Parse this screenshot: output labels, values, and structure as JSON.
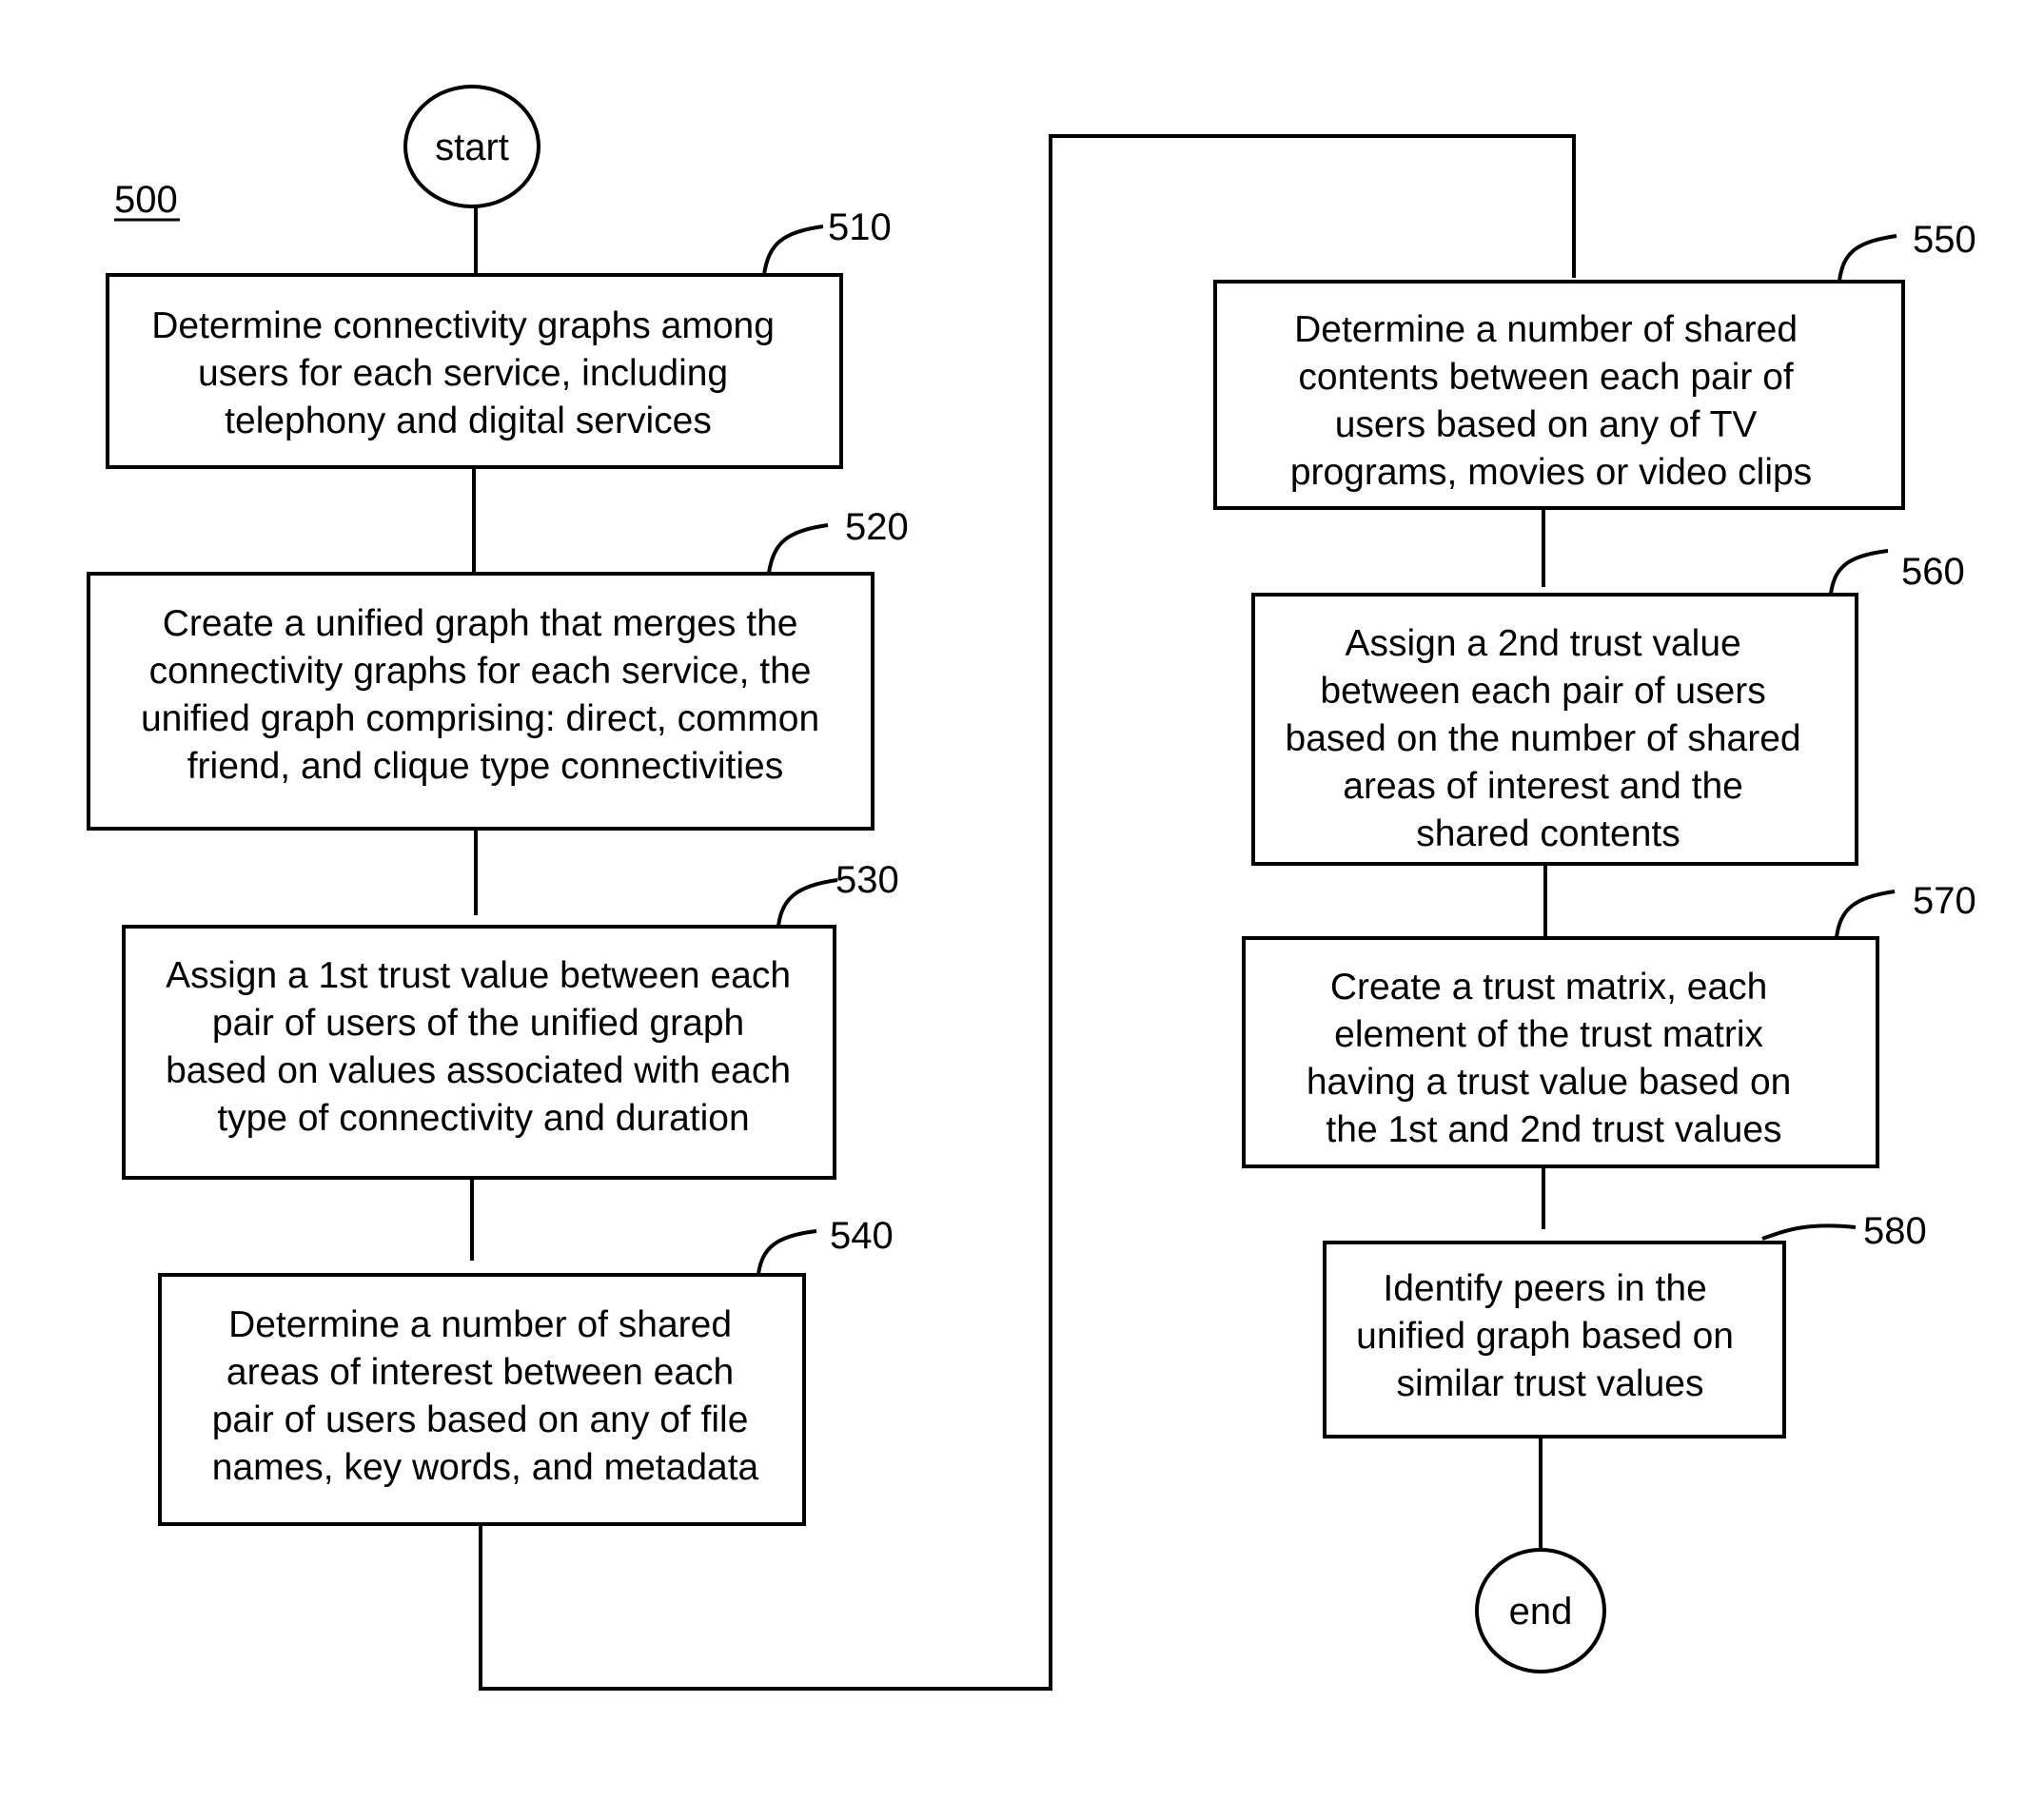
{
  "figure": {
    "reference": "500",
    "start_label": "start",
    "end_label": "end"
  },
  "steps": [
    {
      "id": "510",
      "lines": [
        "Determine connectivity graphs among",
        "users for each service, including",
        "telephony and digital services"
      ]
    },
    {
      "id": "520",
      "lines": [
        "Create a unified graph that merges the",
        "connectivity graphs for each service, the",
        "unified graph comprising: direct, common",
        "friend, and clique type connectivities"
      ]
    },
    {
      "id": "530",
      "lines": [
        "Assign a 1st trust value between each",
        "pair of users of the unified graph",
        "based on values associated with each",
        "type of connectivity and duration"
      ]
    },
    {
      "id": "540",
      "lines": [
        "Determine a number of shared",
        "areas of interest between each",
        "pair of users based on any of file",
        "names, key words, and metadata"
      ]
    },
    {
      "id": "550",
      "lines": [
        "Determine a number of shared",
        "contents between each pair of",
        "users based on any of TV",
        "programs, movies or video clips"
      ]
    },
    {
      "id": "560",
      "lines": [
        "Assign a 2nd trust value",
        "between each pair of users",
        "based on the number of shared",
        "areas of interest and the",
        "shared contents"
      ]
    },
    {
      "id": "570",
      "lines": [
        "Create a trust matrix, each",
        "element of the trust matrix",
        "having a trust value based on",
        "the 1st and 2nd trust values"
      ]
    },
    {
      "id": "580",
      "lines": [
        "Identify peers in the",
        "unified graph based on",
        "similar trust values"
      ]
    }
  ]
}
